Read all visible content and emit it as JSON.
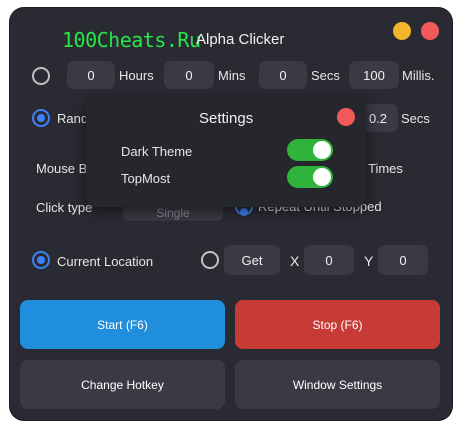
{
  "watermark": "100Cheats.Ru",
  "app": {
    "title": "Alpha Clicker"
  },
  "colors": {
    "minimize": "#f3b52b",
    "close": "#f25a5a",
    "start": "#1f8fdd",
    "stop": "#c73b37",
    "toggle_on": "#2fb33a"
  },
  "interval": {
    "hours_value": "0",
    "hours_label": "Hours",
    "mins_value": "0",
    "mins_label": "Mins",
    "secs_value": "0",
    "secs_label": "Secs",
    "millis_value": "100",
    "millis_label": "Millis."
  },
  "random": {
    "label_partial": "Rand",
    "value": "0.2",
    "unit": "Secs"
  },
  "mouse": {
    "label_partial": "Mouse B",
    "times_label": "Times"
  },
  "click_type": {
    "label": "Click type",
    "value_partial": "Single",
    "repeat_label_partial": "Repeat Until Stopped"
  },
  "location": {
    "current_label": "Current Location",
    "get_label": "Get",
    "x_label": "X",
    "x_value": "0",
    "y_label": "Y",
    "y_value": "0"
  },
  "buttons": {
    "start": "Start (F6)",
    "stop": "Stop (F6)",
    "change_hotkey": "Change Hotkey",
    "window_settings": "Window Settings"
  },
  "settings": {
    "title": "Settings",
    "items": [
      {
        "label": "Dark Theme",
        "on": true
      },
      {
        "label": "TopMost",
        "on": true
      }
    ]
  }
}
